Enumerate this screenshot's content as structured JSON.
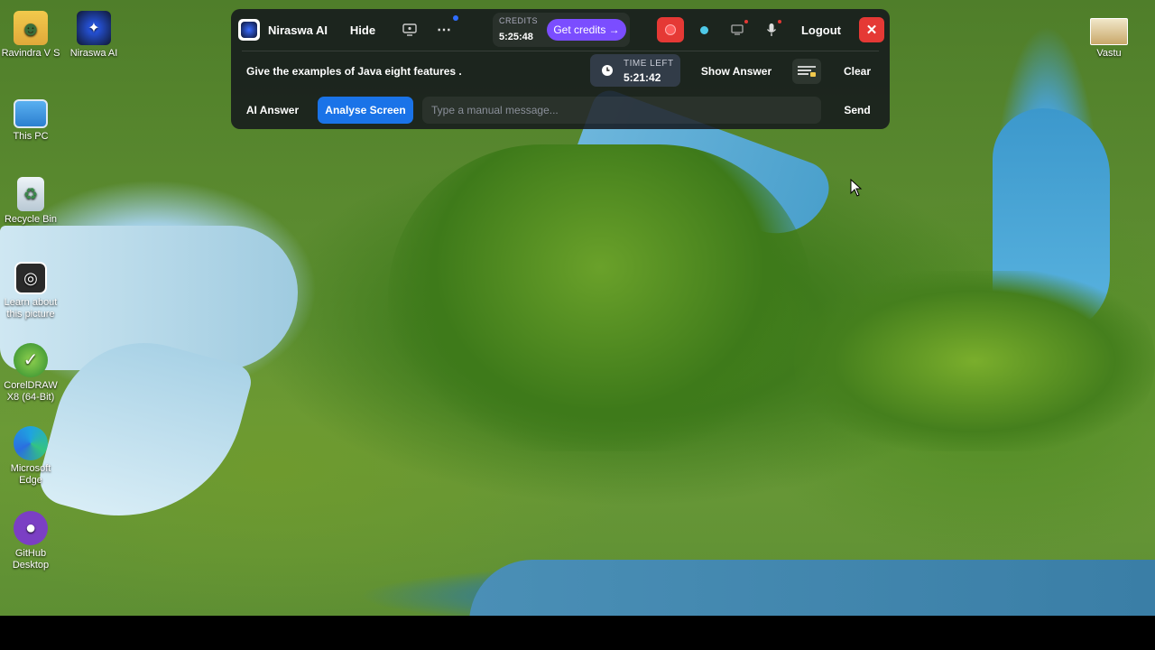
{
  "desktop": {
    "icons": [
      {
        "label": "Ravindra V S",
        "icon": "user-folder-icon"
      },
      {
        "label": "Niraswa AI",
        "icon": "niraswa-app-icon"
      },
      {
        "label": "This PC",
        "icon": "computer-icon"
      },
      {
        "label": "Recycle Bin",
        "icon": "recycle-bin-icon"
      },
      {
        "label": "Learn about this picture",
        "icon": "camera-icon"
      },
      {
        "label": "CorelDRAW X8 (64-Bit)",
        "icon": "coreldraw-icon"
      },
      {
        "label": "Microsoft Edge",
        "icon": "edge-icon"
      },
      {
        "label": "GitHub Desktop",
        "icon": "github-icon"
      },
      {
        "label": "Vastu",
        "icon": "image-file-icon"
      }
    ]
  },
  "app": {
    "name": "Niraswa AI",
    "hide_label": "Hide",
    "credits_label": "CREDITS",
    "credits_value": "5:25:48",
    "get_credits_label": "Get credits →",
    "logout_label": "Logout",
    "question": "Give the examples of Java eight features .",
    "time_left_label": "TIME LEFT",
    "time_left_value": "5:21:42",
    "show_answer_label": "Show Answer",
    "clear_label": "Clear",
    "ai_answer_label": "AI Answer",
    "analyse_screen_label": "Analyse Screen",
    "message_placeholder": "Type a manual message...",
    "send_label": "Send",
    "colors": {
      "accent": "#1a73e8",
      "credits": "#7b4dff",
      "record": "#e53935",
      "close": "#e53935"
    }
  }
}
